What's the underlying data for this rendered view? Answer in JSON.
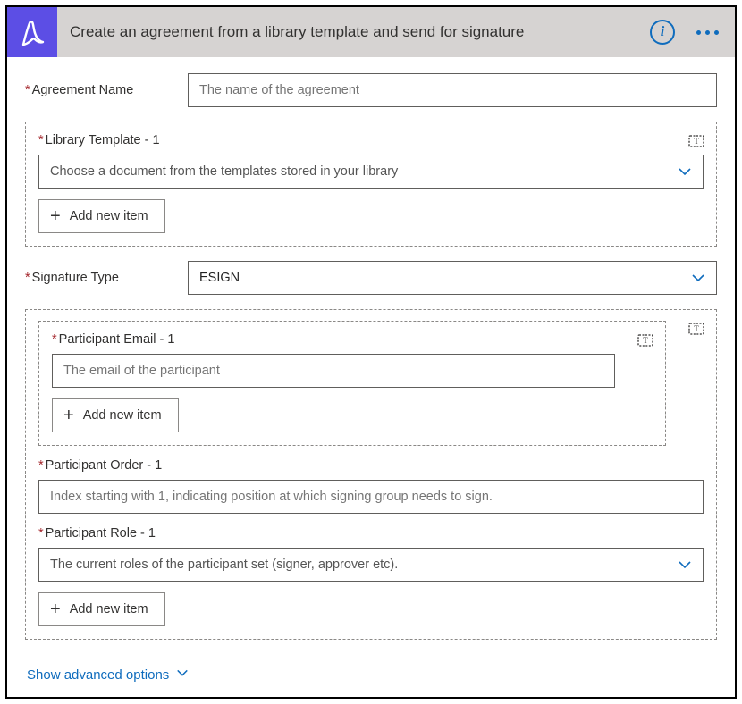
{
  "header": {
    "title": "Create an agreement from a library template and send for signature"
  },
  "fields": {
    "agreement_name": {
      "label": "Agreement Name",
      "placeholder": "The name of the agreement"
    },
    "library_template": {
      "label": "Library Template - 1",
      "placeholder": "Choose a document from the templates stored in your library",
      "add_label": "Add new item"
    },
    "signature_type": {
      "label": "Signature Type",
      "value": "ESIGN"
    },
    "participant_email": {
      "label": "Participant Email - 1",
      "placeholder": "The email of the participant",
      "add_label": "Add new item"
    },
    "participant_order": {
      "label": "Participant Order - 1",
      "placeholder": "Index starting with 1, indicating position at which signing group needs to sign."
    },
    "participant_role": {
      "label": "Participant Role - 1",
      "placeholder": "The current roles of the participant set (signer, approver etc)."
    },
    "participants_add_label": "Add new item"
  },
  "footer": {
    "advanced_label": "Show advanced options"
  }
}
